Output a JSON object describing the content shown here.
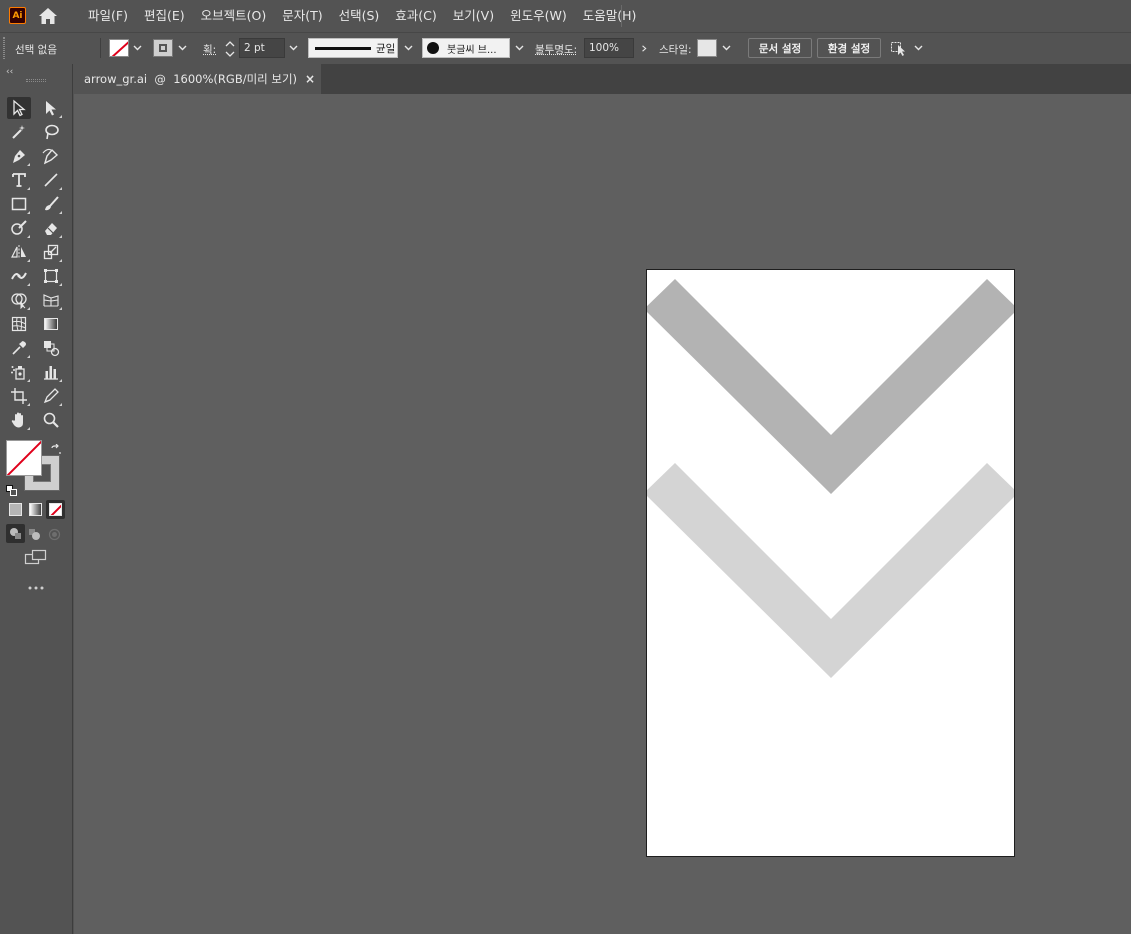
{
  "app": {
    "logo_text": "Ai"
  },
  "menu": [
    "파일(F)",
    "편집(E)",
    "오브젝트(O)",
    "문자(T)",
    "선택(S)",
    "효과(C)",
    "보기(V)",
    "윈도우(W)",
    "도움말(H)"
  ],
  "control_bar": {
    "selection_status": "선택 없음",
    "stroke_label": "획:",
    "stroke_weight": "2 pt",
    "stroke_profile": "균일",
    "brush": "붓글씨 브...",
    "opacity_label": "불투명도:",
    "opacity": "100%",
    "style_label": "스타일:",
    "doc_setup_button": "문서 설정",
    "preferences_button": "환경 설정"
  },
  "document_tab": {
    "title": "arrow_gr.ai  @  1600%(RGB/미리 보기)",
    "close": "×"
  },
  "artwork": {
    "artboard_color": "#ffffff",
    "chevrons": [
      {
        "name": "top-chevron",
        "color": "#b3b3b3"
      },
      {
        "name": "bottom-chevron",
        "color": "#d4d4d4"
      }
    ]
  },
  "colors": {
    "ui_background": "#535353",
    "canvas_background": "#5f5f5f",
    "tab_strip": "#424242",
    "none_swatch_slash": "#e0001b"
  }
}
